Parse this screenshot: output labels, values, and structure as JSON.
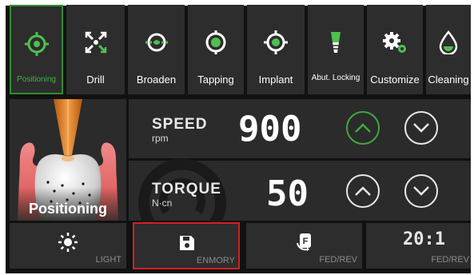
{
  "tabs": [
    {
      "label": "Positioning",
      "icon": "positioning-icon",
      "active": true
    },
    {
      "label": "Drill",
      "icon": "drill-icon"
    },
    {
      "label": "Broaden",
      "icon": "broaden-icon"
    },
    {
      "label": "Tapping",
      "icon": "tapping-icon"
    },
    {
      "label": "Implant",
      "icon": "implant-icon"
    },
    {
      "label": "Abut. Locking",
      "icon": "abut-locking-icon"
    },
    {
      "label": "Customize",
      "icon": "customize-icon"
    },
    {
      "label": "Cleaning",
      "icon": "cleaning-icon"
    }
  ],
  "preview": {
    "label": "Positioning"
  },
  "speed": {
    "label": "SPEED",
    "unit": "rpm",
    "value": "900"
  },
  "torque": {
    "label": "TORQUE",
    "unit": "N·cn",
    "value": "50"
  },
  "bottom": {
    "light_label": "LIGHT",
    "memory_label": "ENMORY",
    "fedrev_label": "FED/REV",
    "ratio_value": "20:1",
    "ratio_label": "FED/REV"
  },
  "colors": {
    "accent_green": "#3fa83f",
    "highlight_red": "#d42020"
  }
}
